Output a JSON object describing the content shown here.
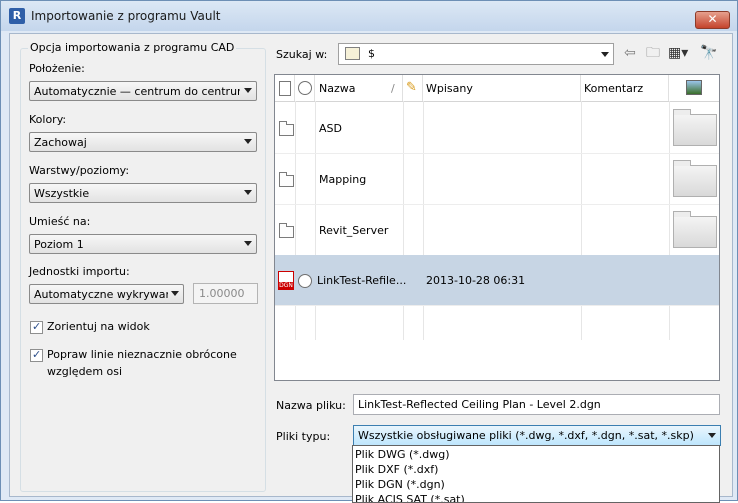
{
  "window": {
    "title": "Importowanie z programu Vault",
    "app_icon": "R",
    "close_label": "✕"
  },
  "left_panel": {
    "group_title": "Opcja importowania z programu CAD",
    "location_label": "Położenie:",
    "location_value": "Automatycznie — centrum do centrum",
    "colors_label": "Kolory:",
    "colors_value": "Zachowaj",
    "layers_label": "Warstwy/poziomy:",
    "layers_value": "Wszystkie",
    "place_label": "Umieść na:",
    "place_value": "Poziom 1",
    "units_label": "Jednostki importu:",
    "units_value": "Automatyczne wykrywanie",
    "units_factor": "1.00000",
    "orient_label": "Zorientuj na widok",
    "orient_checked": true,
    "fix_lines_label_1": "Popraw linie nieznacznie obrócone",
    "fix_lines_label_2": "względem osi",
    "fix_lines_checked": true
  },
  "search": {
    "label": "Szukaj w:",
    "value": "$"
  },
  "file_list": {
    "columns": {
      "name": "Nazwa",
      "sort_marker": "/",
      "checked_in": "Wpisany",
      "comment": "Komentarz"
    },
    "rows": [
      {
        "type": "folder",
        "name": "ASD",
        "checked_in": "",
        "comment": ""
      },
      {
        "type": "folder",
        "name": "Mapping",
        "checked_in": "",
        "comment": ""
      },
      {
        "type": "folder",
        "name": "Revit_Server",
        "checked_in": "",
        "comment": ""
      },
      {
        "type": "dgn",
        "name": "LinkTest-Refile...",
        "checked_in": "2013-10-28 06:31",
        "comment": "",
        "selected": true
      }
    ]
  },
  "file_name": {
    "label": "Nazwa pliku:",
    "value": "LinkTest-Reflected Ceiling Plan  - Level 2.dgn"
  },
  "file_type": {
    "label": "Pliki typu:",
    "value": "Wszystkie obsługiwane pliki (*.dwg, *.dxf, *.dgn, *.sat, *.skp)",
    "options": [
      "Plik DWG (*.dwg)",
      "Plik DXF (*.dxf)",
      "Plik DGN (*.dgn)",
      "Plik ACIS SAT (*.sat)"
    ]
  },
  "dgn_badge": "DGN",
  "colors": {
    "selection": "#c7d5e4",
    "title_bar": "#c4d6ec",
    "dgn_red": "#cc0000"
  }
}
